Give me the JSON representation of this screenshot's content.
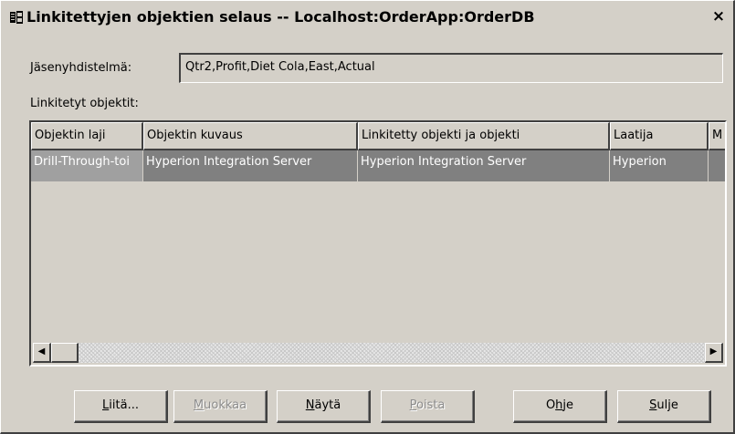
{
  "window": {
    "title": "Linkitettyjen objektien selaus  -- Localhost:OrderApp:OrderDB",
    "close_glyph": "×",
    "icon": "linked-objects-icon"
  },
  "member": {
    "label": "Jäsenyhdistelmä:",
    "value": "Qtr2,Profit,Diet Cola,East,Actual"
  },
  "linked_objects": {
    "label": "Linkitetyt objektit:",
    "columns": [
      "Objektin laji",
      "Objektin kuvaus",
      "Linkitetty objekti ja objekti",
      "Laatija",
      "M"
    ],
    "rows": [
      {
        "type": "Drill-Through-toi",
        "description": "Hyperion Integration Server",
        "linked": "Hyperion Integration Server",
        "author": "Hyperion",
        "m": ""
      }
    ]
  },
  "scrollbar": {
    "left_glyph": "◀",
    "right_glyph": "▶"
  },
  "buttons": [
    {
      "label": "Liitä...",
      "accel": "L",
      "enabled": true
    },
    {
      "label": "Muokkaa",
      "accel": "M",
      "enabled": false
    },
    {
      "label": "Näytä",
      "accel": "N",
      "enabled": true
    },
    {
      "label": "Poista",
      "accel": "P",
      "enabled": false
    },
    {
      "label": "Ohje",
      "accel": "h",
      "enabled": true
    },
    {
      "label": "Sulje",
      "accel": "S",
      "enabled": true
    }
  ],
  "colors": {
    "face": "#d4d0c8",
    "selection": "#808080",
    "disabled_text": "#8c8c8c"
  }
}
